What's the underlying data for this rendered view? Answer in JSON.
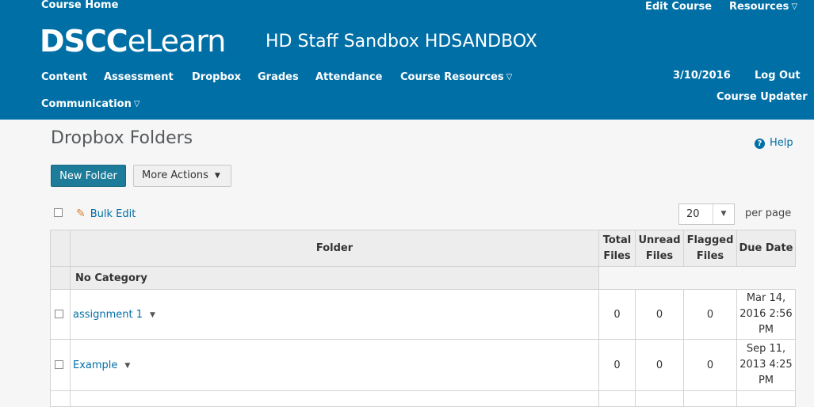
{
  "header": {
    "course_home": "Course Home",
    "edit_course": "Edit Course",
    "resources": "Resources",
    "logo_part1": "DSCC",
    "logo_part2": "eLearn",
    "course_title": "HD Staff Sandbox HDSANDBOX",
    "date": "3/10/2016",
    "logout": "Log Out",
    "course_updater": "Course Updater"
  },
  "nav": {
    "content": "Content",
    "assessment": "Assessment",
    "dropbox": "Dropbox",
    "grades": "Grades",
    "attendance": "Attendance",
    "course_resources": "Course Resources",
    "communication": "Communication"
  },
  "page": {
    "title": "Dropbox Folders",
    "help": "Help",
    "new_folder": "New Folder",
    "more_actions": "More Actions",
    "bulk_edit": "Bulk Edit",
    "per_page_value": "20",
    "per_page_label": "per page"
  },
  "table": {
    "headers": {
      "folder": "Folder",
      "total_1": "Total",
      "total_2": "Files",
      "unread_1": "Unread",
      "unread_2": "Files",
      "flagged_1": "Flagged",
      "flagged_2": "Files",
      "due": "Due Date"
    },
    "category": "No Category",
    "rows": [
      {
        "name": "assignment 1",
        "total": "0",
        "unread": "0",
        "flagged": "0",
        "due_1": "Mar 14,",
        "due_2": "2016 2:56",
        "due_3": "PM"
      },
      {
        "name": "Example",
        "total": "0",
        "unread": "0",
        "flagged": "0",
        "due_1": "Sep 11,",
        "due_2": "2013 4:25",
        "due_3": "PM"
      }
    ]
  },
  "colors": {
    "header_bg": "#006fa6",
    "primary_button": "#1c7c99",
    "link": "#006fa6"
  }
}
